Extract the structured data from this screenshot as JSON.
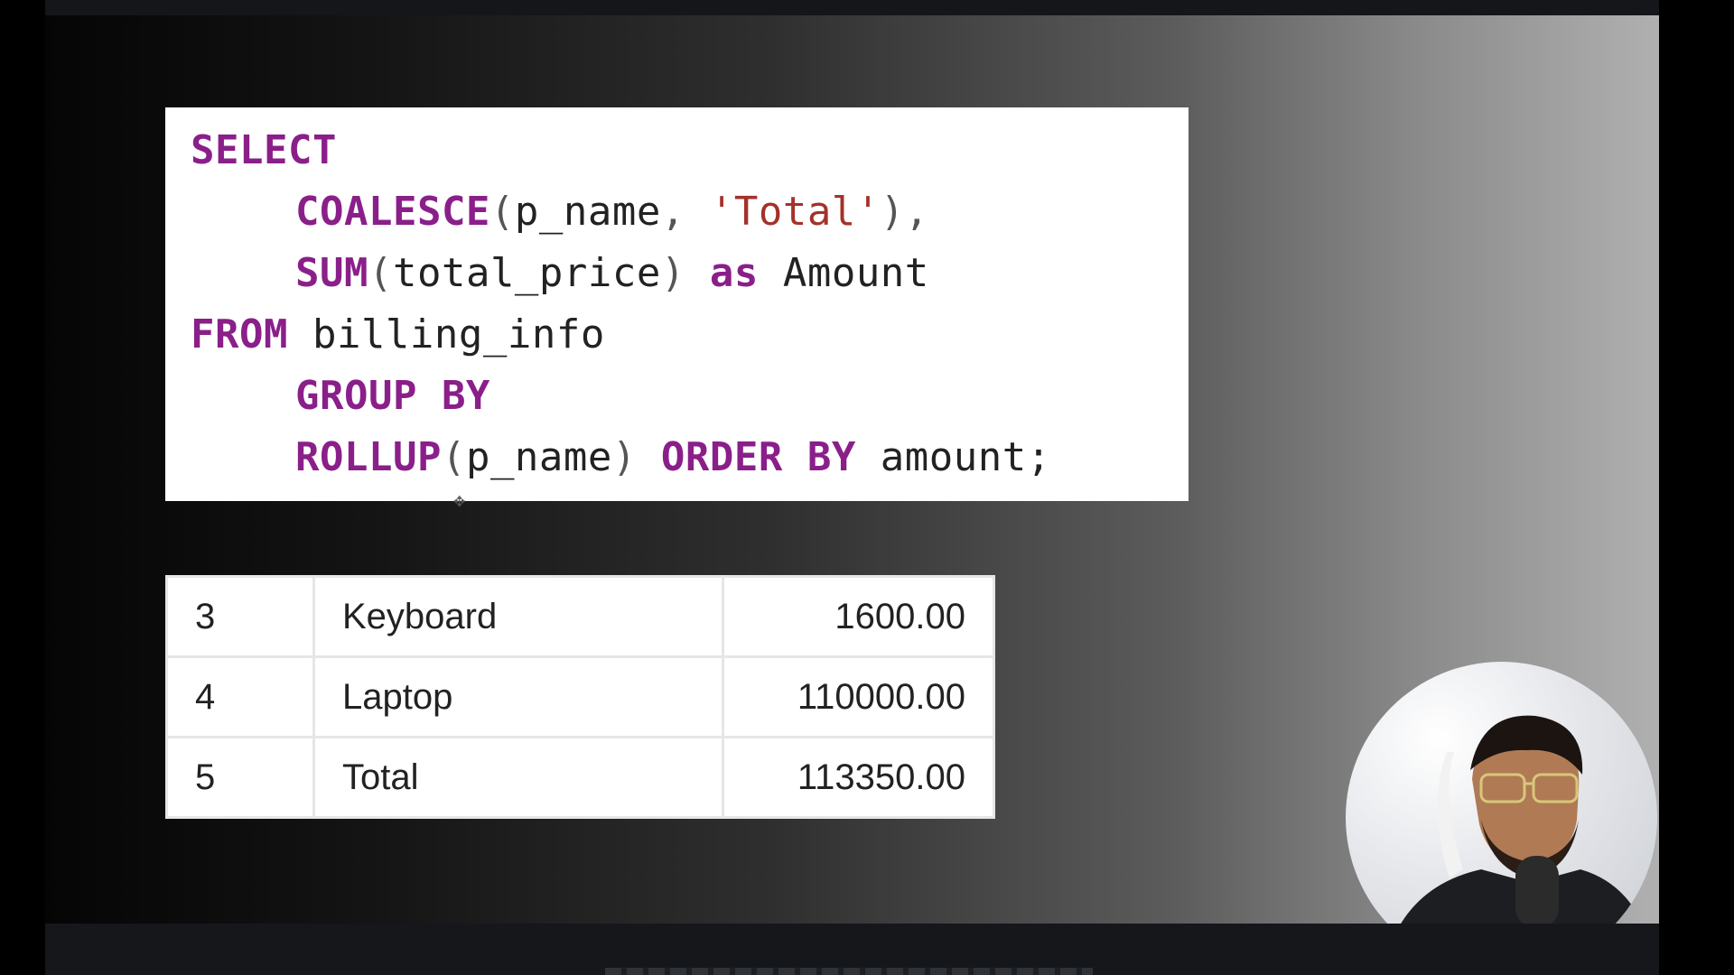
{
  "code": {
    "lines": [
      {
        "segments": [
          {
            "t": "SELECT",
            "c": "kw"
          }
        ]
      },
      {
        "indent": true,
        "segments": [
          {
            "t": "COALESCE",
            "c": "kw"
          },
          {
            "t": "(",
            "c": "punct"
          },
          {
            "t": "p_name",
            "c": "ident"
          },
          {
            "t": ", ",
            "c": "punct"
          },
          {
            "t": "'Total'",
            "c": "str"
          },
          {
            "t": "),",
            "c": "punct"
          }
        ]
      },
      {
        "indent": true,
        "segments": [
          {
            "t": "SUM",
            "c": "kw"
          },
          {
            "t": "(",
            "c": "punct"
          },
          {
            "t": "total_price",
            "c": "ident"
          },
          {
            "t": ") ",
            "c": "punct"
          },
          {
            "t": "as",
            "c": "kw"
          },
          {
            "t": " Amount",
            "c": "ident"
          }
        ]
      },
      {
        "segments": [
          {
            "t": "FROM",
            "c": "kw"
          },
          {
            "t": " billing_info",
            "c": "ident"
          }
        ]
      },
      {
        "indent": true,
        "segments": [
          {
            "t": "GROUP BY",
            "c": "kw"
          }
        ]
      },
      {
        "indent": true,
        "segments": [
          {
            "t": "ROLLUP",
            "c": "kw"
          },
          {
            "t": "(",
            "c": "punct"
          },
          {
            "t": "p_name",
            "c": "ident"
          },
          {
            "t": ") ",
            "c": "punct"
          },
          {
            "t": "ORDER BY",
            "c": "kw"
          },
          {
            "t": " amount;",
            "c": "ident"
          }
        ]
      }
    ]
  },
  "results": {
    "rows": [
      {
        "num": "3",
        "name": "Keyboard",
        "amount": "1600.00"
      },
      {
        "num": "4",
        "name": "Laptop",
        "amount": "110000.00"
      },
      {
        "num": "5",
        "name": "Total",
        "amount": "113350.00"
      }
    ]
  },
  "colors": {
    "keyword": "#8a1f8a",
    "string": "#a3322a",
    "identifier": "#222222"
  },
  "webcam": {
    "icon": "presenter-avatar"
  }
}
